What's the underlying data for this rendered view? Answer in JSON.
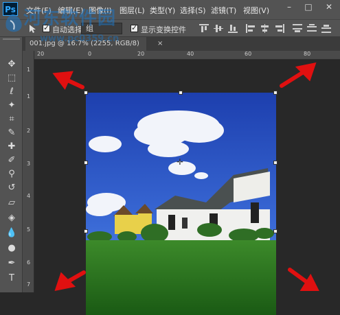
{
  "menubar": {
    "app_logo": "Ps",
    "items": [
      "文件(F)",
      "编辑(E)",
      "图像(I)",
      "图层(L)",
      "类型(Y)",
      "选择(S)",
      "滤镜(T)",
      "视图(V)"
    ],
    "window_controls": [
      "–",
      "□",
      "✕"
    ]
  },
  "watermark": {
    "title": "河东软件园",
    "url": "www.pc0359.cn"
  },
  "options": {
    "auto_select_label": "自动选择:",
    "auto_select_value": "组",
    "transform_label": "显示变换控件"
  },
  "document": {
    "tab_title": "001.jpg @ 16.7% (2255, RGB/8)",
    "tab_close": "×"
  },
  "rulers": {
    "top": [
      "20",
      "0",
      "20",
      "40",
      "60",
      "80"
    ],
    "left": [
      "1",
      "1",
      "2",
      "3",
      "4",
      "5",
      "6",
      "7"
    ]
  },
  "tools": [
    "move-tool",
    "marquee-tool",
    "lasso-tool",
    "magic-wand-tool",
    "crop-tool",
    "eyedropper-tool",
    "healing-brush-tool",
    "brush-tool",
    "clone-stamp-tool",
    "history-brush-tool",
    "eraser-tool",
    "paint-bucket-tool",
    "blur-tool",
    "dodge-tool",
    "pen-tool",
    "type-tool"
  ],
  "colors": {
    "accent": "#31a8ff",
    "arrow": "#e01010",
    "panel": "#535353",
    "workspace": "#282828"
  }
}
